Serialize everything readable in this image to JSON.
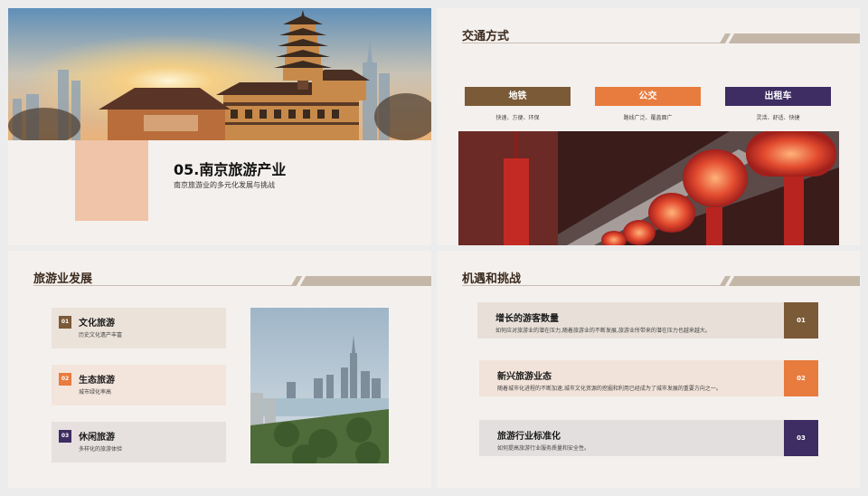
{
  "slide1": {
    "title": "05.南京旅游产业",
    "subtitle": "南京旅游业的多元化发展与挑战"
  },
  "slide2": {
    "title": "交通方式",
    "modes": [
      {
        "label": "地铁",
        "desc": "快速、方便、环保",
        "color": "#7b5a37"
      },
      {
        "label": "公交",
        "desc": "路线广泛、覆盖面广",
        "color": "#e87b3e"
      },
      {
        "label": "出租车",
        "desc": "灵活、舒适、快捷",
        "color": "#3d2d62"
      }
    ]
  },
  "slide3": {
    "title": "旅游业发展",
    "items": [
      {
        "num": "01",
        "title": "文化旅游",
        "desc": "历史文化遗产丰富",
        "numColor": "#7b5a37",
        "bg": "#ebe2d9"
      },
      {
        "num": "02",
        "title": "生态旅游",
        "desc": "城市绿化率高",
        "numColor": "#e87b3e",
        "bg": "#f3e5dc"
      },
      {
        "num": "03",
        "title": "休闲旅游",
        "desc": "多样化的旅游体验",
        "numColor": "#3d2d62",
        "bg": "#e6e0df"
      }
    ]
  },
  "slide4": {
    "title": "机遇和挑战",
    "items": [
      {
        "num": "01",
        "title": "增长的游客数量",
        "desc": "如何应对旅游业的潜在压力,随着旅游业的不断发展,旅游业所带来的潜在压力也越来越大。",
        "numColor": "#7b5a37",
        "bg": "#e8e0d8"
      },
      {
        "num": "02",
        "title": "新兴旅游业态",
        "desc": "随着城市化进程的不断加速,城市文化资源的挖掘和利用已经成为了城市发展的重要方向之一。",
        "numColor": "#e87b3e",
        "bg": "#f1e3d9"
      },
      {
        "num": "03",
        "title": "旅游行业标准化",
        "desc": "如何提高旅游行业服务质量和安全性。",
        "numColor": "#3d2d62",
        "bg": "#e4dfdf"
      }
    ]
  },
  "colors": {
    "brown": "#7b5a37",
    "orange": "#e87b3e",
    "purple": "#3d2d62",
    "peach": "#f0c4a8",
    "slideBg": "#f4f0ed"
  }
}
